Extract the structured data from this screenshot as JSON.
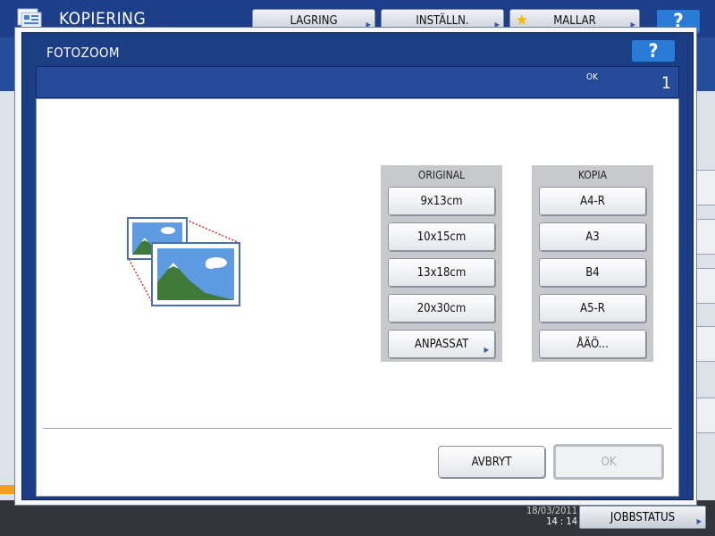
{
  "background": {
    "title": "KOPIERING",
    "tabs": [
      {
        "label": "LAGRING"
      },
      {
        "label": "INSTÄLLN."
      },
      {
        "label": "MALLAR"
      }
    ],
    "help_label": "?",
    "time": "14 : 14",
    "date": "18/03/2011",
    "job_status": "JOBBSTATUS"
  },
  "dialog": {
    "title": "FOTOZOOM",
    "help_label": "?",
    "status_text": "OK",
    "copies": "1",
    "original": {
      "heading": "ORIGINAL",
      "options": [
        "9x13cm",
        "10x15cm",
        "13x18cm",
        "20x30cm",
        "ANPASSAT"
      ]
    },
    "copy": {
      "heading": "KOPIA",
      "options": [
        "A4-R",
        "A3",
        "B4",
        "A5-R",
        "ÅÄÖ..."
      ]
    },
    "cancel_label": "AVBRYT",
    "ok_label": "OK"
  },
  "colors": {
    "title_bar": "#1c3c84",
    "status_bar": "#244a99",
    "help_button": "#2a7bd6",
    "group_bg": "#c7c9cd"
  }
}
